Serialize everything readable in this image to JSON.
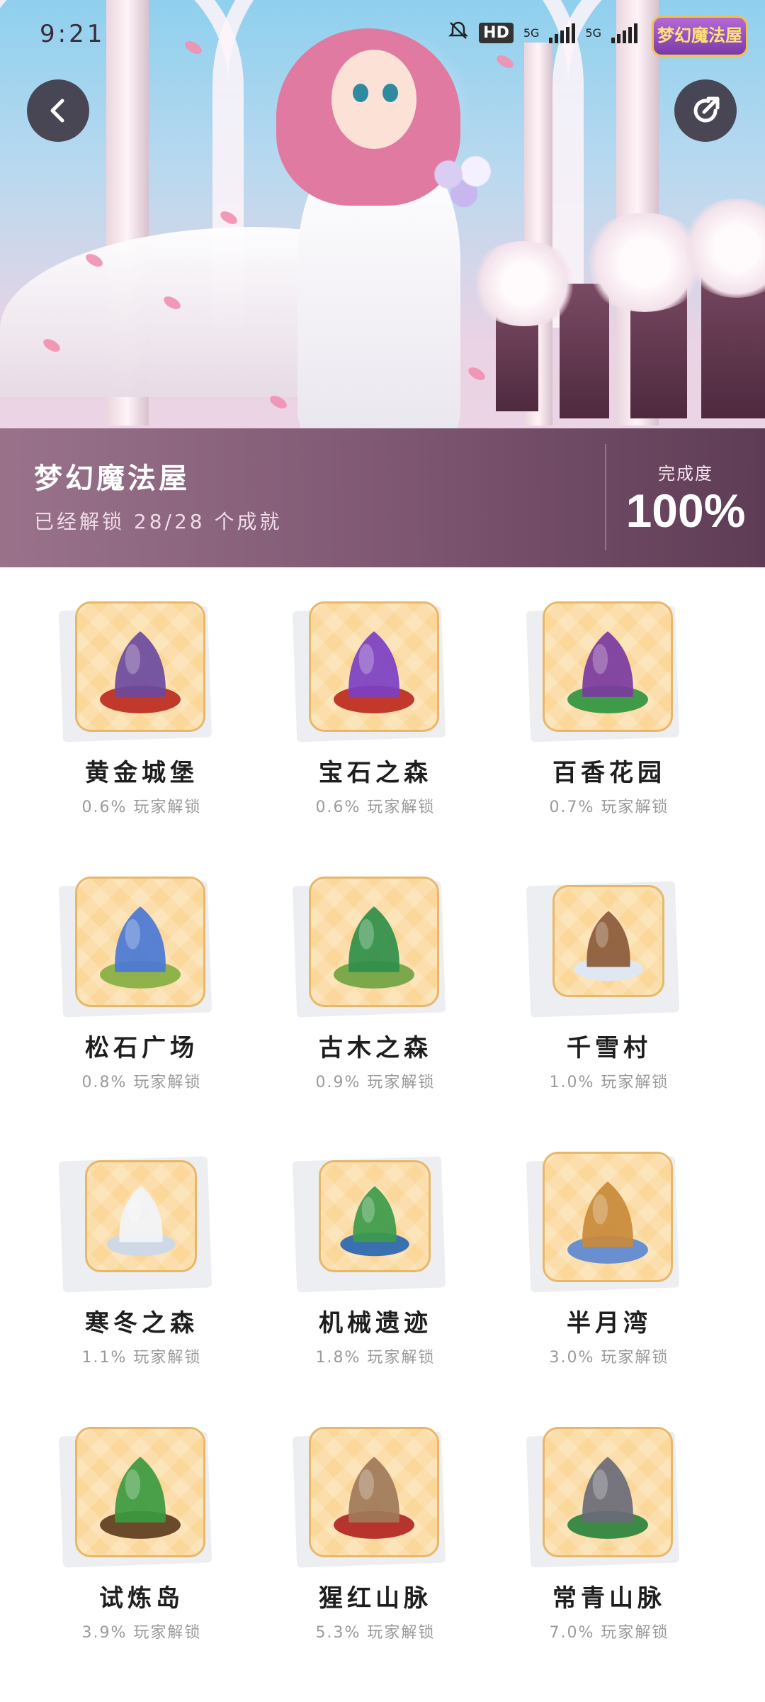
{
  "status_bar": {
    "time": "9:21",
    "hd_badge": "HD",
    "network_1": "5G",
    "network_2": "5G",
    "app_logo_text": "梦幻魔法屋"
  },
  "header": {
    "title": "梦幻魔法屋",
    "subtitle": "已经解锁 28/28 个成就",
    "completion_label": "完成度",
    "completion_value": "100%"
  },
  "achievements": [
    {
      "name": "黄金城堡",
      "rate": "0.6% 玩家解锁",
      "icon": "castle-tower-icon",
      "accent": "#6b4aa0",
      "base": "#c0392b"
    },
    {
      "name": "宝石之森",
      "rate": "0.6% 玩家解锁",
      "icon": "purple-crystal-icon",
      "accent": "#7b3fc4",
      "base": "#c0392b"
    },
    {
      "name": "百香花园",
      "rate": "0.7% 玩家解锁",
      "icon": "garden-cauldron-icon",
      "accent": "#7a3aa0",
      "base": "#3f9a4a"
    },
    {
      "name": "松石广场",
      "rate": "0.8% 玩家解锁",
      "icon": "blue-tree-icon",
      "accent": "#4a78d6",
      "base": "#8fb34a"
    },
    {
      "name": "古木之森",
      "rate": "0.9% 玩家解锁",
      "icon": "ancient-tree-icon",
      "accent": "#2f8f4a",
      "base": "#7aa84a"
    },
    {
      "name": "千雪村",
      "rate": "1.0% 玩家解锁",
      "icon": "snow-house-icon",
      "accent": "#8a5a3a",
      "base": "#dfe8f2"
    },
    {
      "name": "寒冬之森",
      "rate": "1.1% 玩家解锁",
      "icon": "snowy-rock-icon",
      "accent": "#f2f4f8",
      "base": "#cfd9e6"
    },
    {
      "name": "机械遗迹",
      "rate": "1.8% 玩家解锁",
      "icon": "green-mountain-icon",
      "accent": "#3c9a4a",
      "base": "#3a6fb0"
    },
    {
      "name": "半月湾",
      "rate": "3.0% 玩家解锁",
      "icon": "cave-hill-icon",
      "accent": "#c98a3a",
      "base": "#6a8fd0"
    },
    {
      "name": "试炼岛",
      "rate": "3.9% 玩家解锁",
      "icon": "jungle-tree-icon",
      "accent": "#3b9a3f",
      "base": "#6a4a2a"
    },
    {
      "name": "猩红山脉",
      "rate": "5.3% 玩家解锁",
      "icon": "dead-tree-icon",
      "accent": "#a07a5a",
      "base": "#b7332e"
    },
    {
      "name": "常青山脉",
      "rate": "7.0% 玩家解锁",
      "icon": "evergreen-rock-icon",
      "accent": "#6a6a78",
      "base": "#3c8a44"
    }
  ]
}
